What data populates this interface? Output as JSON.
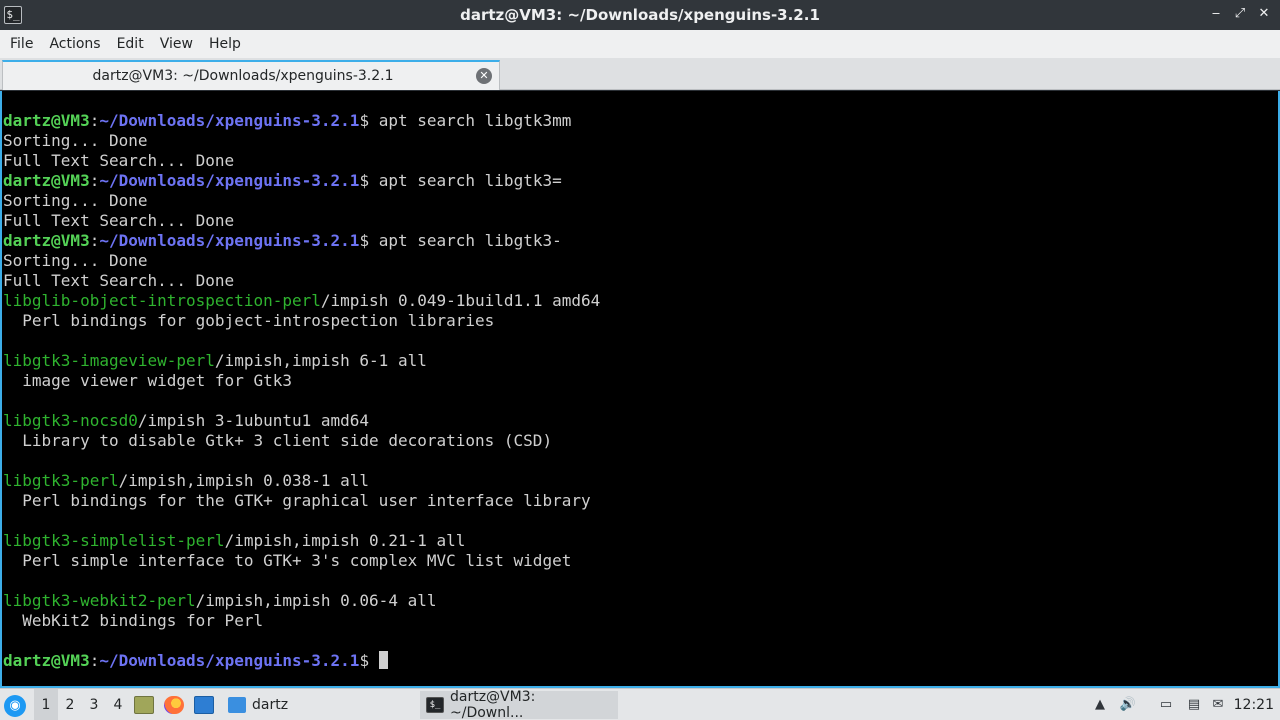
{
  "window": {
    "title": "dartz@VM3: ~/Downloads/xpenguins-3.2.1",
    "app_icon_glyph": "$_",
    "buttons": {
      "minimize": "‒",
      "maximize": "⤢",
      "close": "✕"
    }
  },
  "menu": [
    "File",
    "Actions",
    "Edit",
    "View",
    "Help"
  ],
  "tab": {
    "label": "dartz@VM3: ~/Downloads/xpenguins-3.2.1",
    "close_glyph": "✕"
  },
  "terminal": {
    "prompt": {
      "user": "dartz@VM3",
      "sep": ":",
      "path": "~/Downloads/xpenguins-3.2.1",
      "symbol": "$ "
    },
    "lines": [
      {
        "type": "prompt",
        "cmd": "apt search libgtk3mm"
      },
      {
        "type": "text",
        "text": "Sorting... Done"
      },
      {
        "type": "text",
        "text": "Full Text Search... Done"
      },
      {
        "type": "prompt",
        "cmd": "apt search libgtk3="
      },
      {
        "type": "text",
        "text": "Sorting... Done"
      },
      {
        "type": "text",
        "text": "Full Text Search... Done"
      },
      {
        "type": "prompt",
        "cmd": "apt search libgtk3-"
      },
      {
        "type": "text",
        "text": "Sorting... Done"
      },
      {
        "type": "text",
        "text": "Full Text Search... Done"
      },
      {
        "type": "pkg",
        "name": "libglib-object-introspection-perl",
        "rest": "/impish 0.049-1build1.1 amd64"
      },
      {
        "type": "text",
        "text": "  Perl bindings for gobject-introspection libraries"
      },
      {
        "type": "text",
        "text": ""
      },
      {
        "type": "pkg",
        "name": "libgtk3-imageview-perl",
        "rest": "/impish,impish 6-1 all"
      },
      {
        "type": "text",
        "text": "  image viewer widget for Gtk3"
      },
      {
        "type": "text",
        "text": ""
      },
      {
        "type": "pkg",
        "name": "libgtk3-nocsd0",
        "rest": "/impish 3-1ubuntu1 amd64"
      },
      {
        "type": "text",
        "text": "  Library to disable Gtk+ 3 client side decorations (CSD)"
      },
      {
        "type": "text",
        "text": ""
      },
      {
        "type": "pkg",
        "name": "libgtk3-perl",
        "rest": "/impish,impish 0.038-1 all"
      },
      {
        "type": "text",
        "text": "  Perl bindings for the GTK+ graphical user interface library"
      },
      {
        "type": "text",
        "text": ""
      },
      {
        "type": "pkg",
        "name": "libgtk3-simplelist-perl",
        "rest": "/impish,impish 0.21-1 all"
      },
      {
        "type": "text",
        "text": "  Perl simple interface to GTK+ 3's complex MVC list widget"
      },
      {
        "type": "text",
        "text": ""
      },
      {
        "type": "pkg",
        "name": "libgtk3-webkit2-perl",
        "rest": "/impish,impish 0.06-4 all"
      },
      {
        "type": "text",
        "text": "  WebKit2 bindings for Perl"
      },
      {
        "type": "text",
        "text": ""
      },
      {
        "type": "prompt",
        "cmd": "",
        "cursor": true
      }
    ]
  },
  "taskbar": {
    "start_glyph": "◉",
    "desktops": [
      "1",
      "2",
      "3",
      "4"
    ],
    "active_desktop": 0,
    "tasks": [
      {
        "label": "dartz",
        "icon": "folder-icon",
        "active": false
      },
      {
        "label": "dartz@VM3: ~/Downl...",
        "icon": "terminal-icon",
        "active": true
      }
    ],
    "tray": {
      "updates": "▲",
      "volume": "🔊",
      "network": "▭",
      "clipboard": "▤",
      "notifications": "✉"
    },
    "clock": "12:21"
  },
  "colors": {
    "accent": "#3daee9",
    "prompt_user": "#54d256",
    "prompt_path": "#6d73f3",
    "package_name": "#2fb32f",
    "terminal_bg": "#000000",
    "terminal_fg": "#d0d0d0"
  }
}
